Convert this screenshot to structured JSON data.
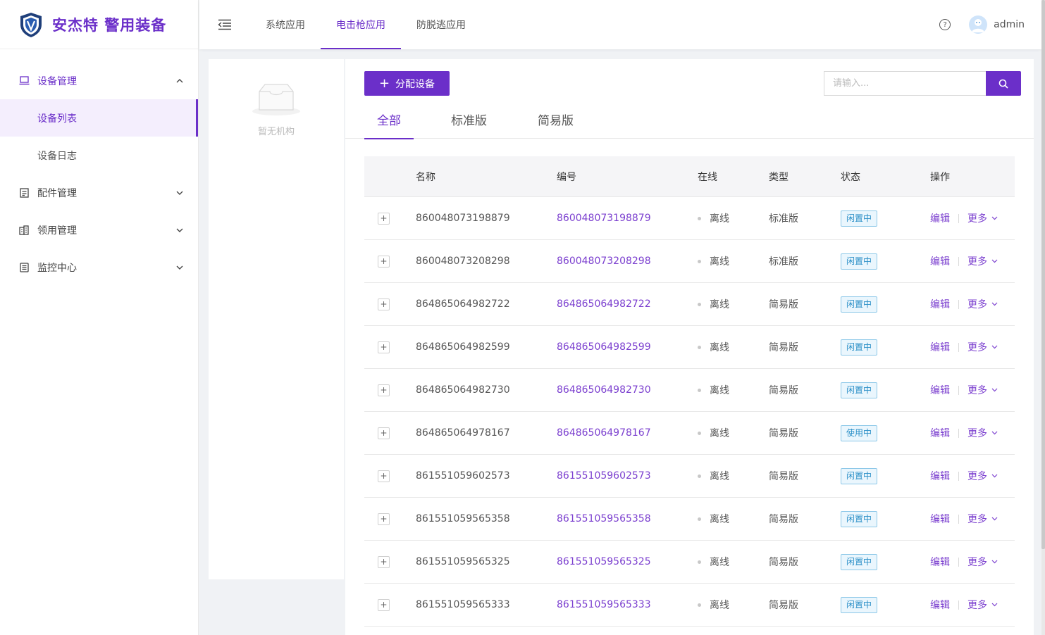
{
  "brand": {
    "name": "安杰特 警用装备",
    "accent": "#6b2fc9"
  },
  "sidebar": {
    "groups": [
      {
        "label": "设备管理",
        "icon": "laptop-icon",
        "expanded": true,
        "children": [
          {
            "label": "设备列表",
            "active": true
          },
          {
            "label": "设备日志",
            "active": false
          }
        ]
      },
      {
        "label": "配件管理",
        "icon": "document-icon",
        "expanded": false
      },
      {
        "label": "领用管理",
        "icon": "building-icon",
        "expanded": false
      },
      {
        "label": "监控中心",
        "icon": "monitor-icon",
        "expanded": false
      }
    ]
  },
  "header": {
    "tabs": [
      {
        "label": "系统应用",
        "active": false
      },
      {
        "label": "电击枪应用",
        "active": true
      },
      {
        "label": "防脱逃应用",
        "active": false
      }
    ],
    "help_icon": "?",
    "user": "admin"
  },
  "org_panel": {
    "empty_text": "暂无机构"
  },
  "toolbar": {
    "add_label": "分配设备",
    "add_plus": "+",
    "search_placeholder": "请输入..."
  },
  "tabs": [
    {
      "label": "全部",
      "active": true
    },
    {
      "label": "标准版",
      "active": false
    },
    {
      "label": "简易版",
      "active": false
    }
  ],
  "table": {
    "columns": {
      "name": "名称",
      "code": "编号",
      "online": "在线",
      "type": "类型",
      "status": "状态",
      "ops": "操作"
    },
    "expand_symbol": "+",
    "edit_label": "编辑",
    "more_label": "更多",
    "rows": [
      {
        "name": "860048073198879",
        "code": "860048073198879",
        "online": "离线",
        "type": "标准版",
        "status": "闲置中"
      },
      {
        "name": "860048073208298",
        "code": "860048073208298",
        "online": "离线",
        "type": "标准版",
        "status": "闲置中"
      },
      {
        "name": "864865064982722",
        "code": "864865064982722",
        "online": "离线",
        "type": "简易版",
        "status": "闲置中"
      },
      {
        "name": "864865064982599",
        "code": "864865064982599",
        "online": "离线",
        "type": "简易版",
        "status": "闲置中"
      },
      {
        "name": "864865064982730",
        "code": "864865064982730",
        "online": "离线",
        "type": "简易版",
        "status": "闲置中"
      },
      {
        "name": "864865064978167",
        "code": "864865064978167",
        "online": "离线",
        "type": "简易版",
        "status": "使用中"
      },
      {
        "name": "861551059602573",
        "code": "861551059602573",
        "online": "离线",
        "type": "简易版",
        "status": "闲置中"
      },
      {
        "name": "861551059565358",
        "code": "861551059565358",
        "online": "离线",
        "type": "简易版",
        "status": "闲置中"
      },
      {
        "name": "861551059565325",
        "code": "861551059565325",
        "online": "离线",
        "type": "简易版",
        "status": "闲置中"
      },
      {
        "name": "861551059565333",
        "code": "861551059565333",
        "online": "离线",
        "type": "简易版",
        "status": "闲置中"
      }
    ]
  }
}
